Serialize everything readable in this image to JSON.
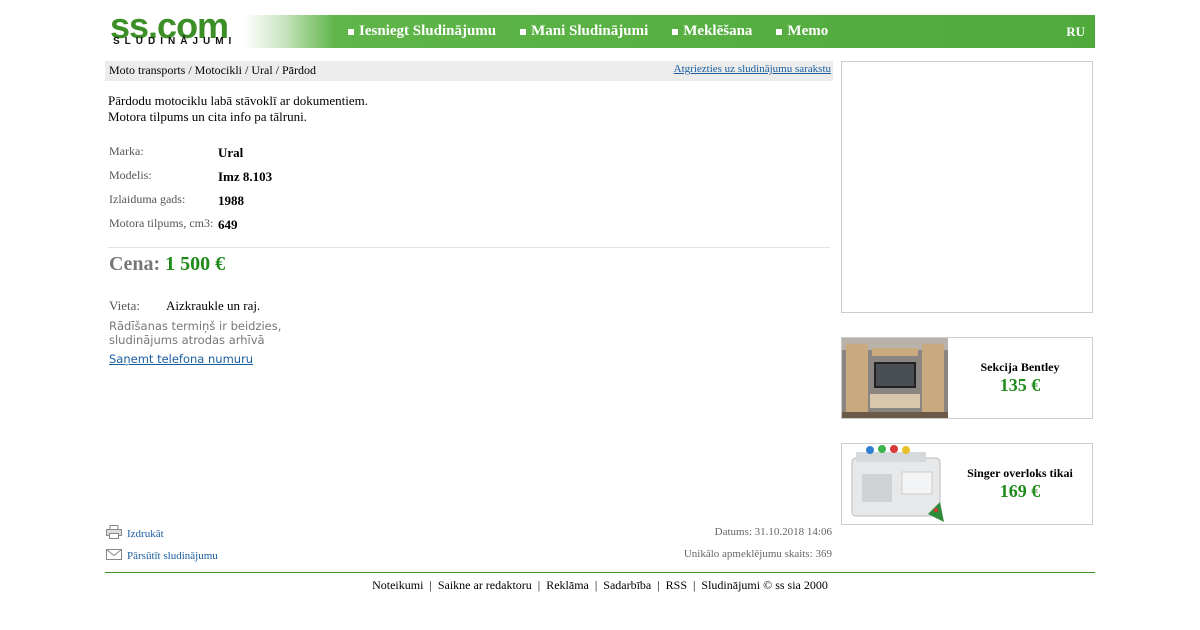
{
  "header": {
    "logo_main": "ss.com",
    "logo_sub": "SLUDINĀJUMI",
    "nav": [
      "Iesniegt Sludinājumu",
      "Mani Sludinājumi",
      "Meklēšana",
      "Memo"
    ],
    "lang": "RU",
    "colors": {
      "brand_green": "#4fa93b",
      "price_green": "#1f8c1a"
    }
  },
  "breadcrumb": {
    "path": "Moto transports / Motocikli / Ural / Pārdod",
    "back_link": "Atgriezties uz sludinājumu sarakstu"
  },
  "description": {
    "line1": "Pārdodu motociklu labā stāvoklī ar dokumentiem.",
    "line2": "Motora tilpums un cita info pa tālruni."
  },
  "options": [
    {
      "label": "Marka:",
      "value": "Ural"
    },
    {
      "label": "Modelis:",
      "value": "Imz 8.103"
    },
    {
      "label": "Izlaiduma gads:",
      "value": "1988"
    },
    {
      "label": "Motora tilpums, cm3:",
      "value": "649"
    }
  ],
  "price": {
    "label": "Cena:",
    "value": "1 500 €"
  },
  "place": {
    "label": "Vieta:",
    "value": "Aizkraukle un raj."
  },
  "expired": {
    "line1": "Rādīšanas termiņš ir beidzies,",
    "line2": "sludinājums atrodas arhīvā"
  },
  "phone_link": "Saņemt telefona numuru",
  "actions": {
    "print": {
      "label": "Izdrukāt",
      "icon": "printer-icon"
    },
    "forward": {
      "label": "Pārsūtīt sludinājumu",
      "icon": "envelope-icon"
    }
  },
  "meta": {
    "date": "Datums: 31.10.2018 14:06",
    "views": "Unikālo apmeklējumu skaits: 369"
  },
  "footer": [
    "Noteikumi",
    "Saikne ar redaktoru",
    "Reklāma",
    "Sadarbība",
    "RSS",
    "Sludinājumi © ss sia 2000"
  ],
  "promos": [
    {
      "title": "Sekcija Bentley",
      "price": "135 €"
    },
    {
      "title": "Singer overloks tikai",
      "price": "169 €"
    }
  ]
}
